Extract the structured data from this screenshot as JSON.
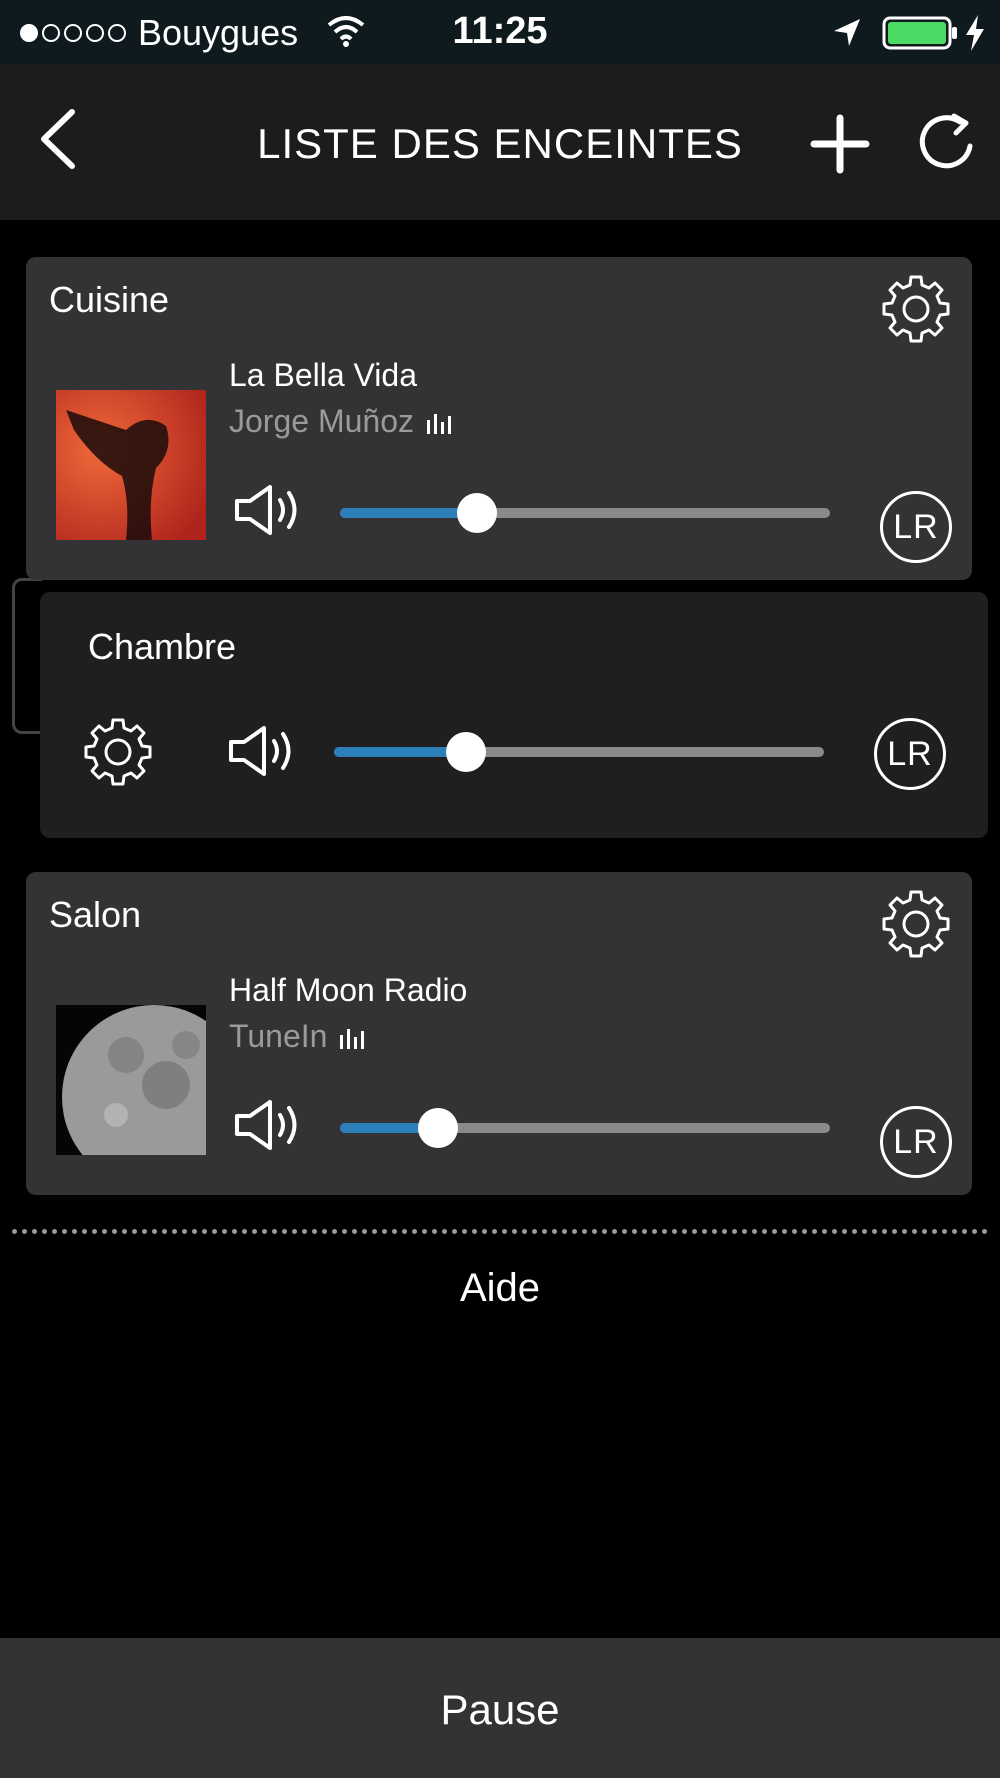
{
  "status_bar": {
    "carrier": "Bouygues",
    "time": "11:25",
    "signal_bars_on": 1,
    "signal_bars_total": 5,
    "battery_color": "#4cd964"
  },
  "header": {
    "title": "LISTE DES ENCEINTES",
    "icons": [
      "back-icon",
      "plus-icon",
      "refresh-icon"
    ]
  },
  "speakers": [
    {
      "room": "Cuisine",
      "track": "La Bella Vida",
      "artist": "Jorge Muñoz",
      "volume": 0.28,
      "channel": "LR"
    },
    {
      "room": "Chambre",
      "volume": 0.27,
      "channel": "LR"
    },
    {
      "room": "Salon",
      "track": "Half Moon Radio",
      "artist": "TuneIn",
      "volume": 0.2,
      "channel": "LR"
    }
  ],
  "help_label": "Aide",
  "pause_label": "Pause",
  "colors": {
    "accent": "#2c7fb8",
    "card": "#333335",
    "card_dark": "#1f1f21"
  }
}
